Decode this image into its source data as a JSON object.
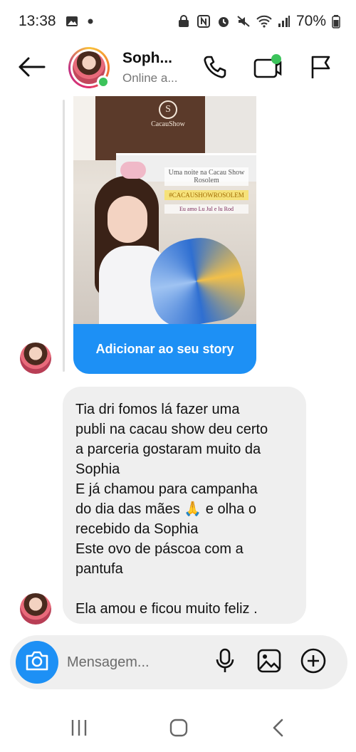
{
  "status_bar": {
    "time": "13:38",
    "battery": "70%",
    "icons": [
      "gallery-icon",
      "dot-icon",
      "lock-icon",
      "nfc-icon",
      "alarm-icon",
      "mute-icon",
      "wifi-icon",
      "signal-icon",
      "battery-icon"
    ]
  },
  "header": {
    "name": "Soph...",
    "status": "Online a...",
    "icons": [
      "back-arrow-icon",
      "phone-icon",
      "video-icon",
      "flag-icon"
    ],
    "online_color": "#3cc35b"
  },
  "story_share": {
    "logo_text": "CacauShow",
    "sticker_line1": "Uma noite na Cacau Show Rosolem",
    "sticker_tag": "#CACAUSHOWROSOLEM",
    "sticker_line3": "Eu amo Lu Jul e lu Rod",
    "action_label": "Adicionar ao seu story",
    "action_color": "#1d90f5"
  },
  "message": {
    "text": "Tia dri fomos lá fazer uma\npubli na cacau show deu certo\na parceria gostaram muito da\nSophia\nE já chamou para campanha\ndo dia das mães 🙏 e olha o\nrecebido da Sophia\nEste ovo de páscoa com a\npantufa\n\nEla amou e ficou muito feliz ."
  },
  "composer": {
    "placeholder": "Mensagem...",
    "icons": [
      "camera-icon",
      "microphone-icon",
      "image-icon",
      "add-circle-icon"
    ]
  },
  "nav": {
    "icons": [
      "recent-apps-icon",
      "home-icon",
      "back-icon"
    ]
  }
}
